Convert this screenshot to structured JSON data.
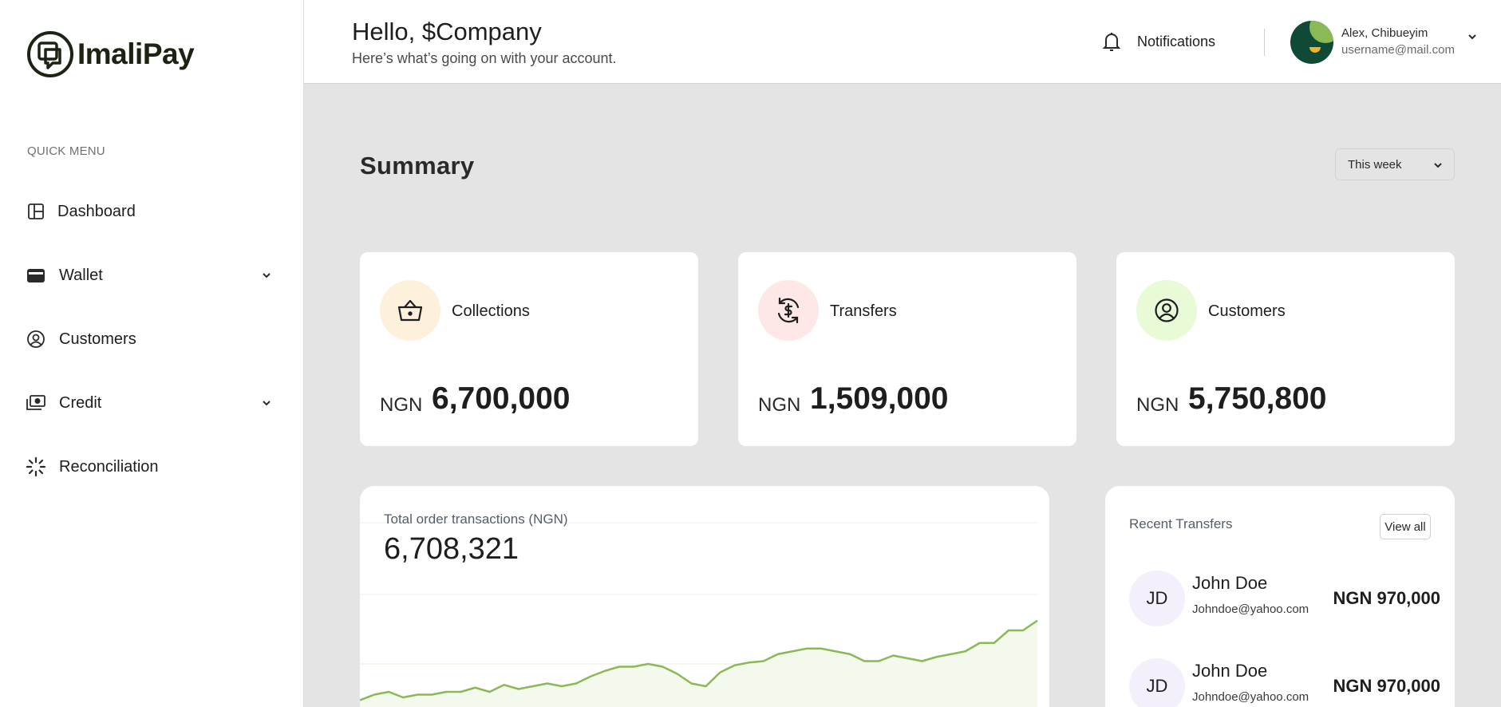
{
  "brand": {
    "name": "ImaliPay",
    "color": "#1b2413"
  },
  "sidebar": {
    "section_label": "QUICK MENU",
    "items": [
      {
        "label": "Dashboard",
        "icon": "dashboard-icon",
        "has_submenu": false
      },
      {
        "label": "Wallet",
        "icon": "wallet-icon",
        "has_submenu": true
      },
      {
        "label": "Customers",
        "icon": "user-circle-icon",
        "has_submenu": false
      },
      {
        "label": "Credit",
        "icon": "cash-icon",
        "has_submenu": true
      },
      {
        "label": "Reconciliation",
        "icon": "loader-icon",
        "has_submenu": false
      }
    ]
  },
  "header": {
    "greeting": "Hello, $Company",
    "subtitle": "Here’s what’s going on with your account.",
    "notifications_label": "Notifications",
    "user": {
      "name": "Alex, Chibueyim",
      "email": "username@mail.com"
    }
  },
  "summary": {
    "title": "Summary",
    "period": {
      "selected": "This week"
    },
    "cards": [
      {
        "label": "Collections",
        "currency": "NGN",
        "amount": "6,700,000",
        "icon": "basket-icon",
        "icon_bg": "#fdf1dc"
      },
      {
        "label": "Transfers",
        "currency": "NGN",
        "amount": "1,509,000",
        "icon": "dollar-refresh-icon",
        "icon_bg": "#fde7e7"
      },
      {
        "label": "Customers",
        "currency": "NGN",
        "amount": "5,750,800",
        "icon": "user-circle-icon",
        "icon_bg": "#e9fad7"
      }
    ]
  },
  "transactions_chart": {
    "title": "Total order transactions (NGN)",
    "total": "6,708,321"
  },
  "chart_data": {
    "type": "area",
    "title": "Total order transactions (NGN)",
    "color": "#8ab956",
    "ylim": [
      0,
      100
    ],
    "values": [
      18,
      22,
      24,
      20,
      22,
      22,
      24,
      24,
      27,
      24,
      29,
      26,
      28,
      30,
      28,
      30,
      35,
      39,
      42,
      42,
      44,
      42,
      37,
      30,
      28,
      38,
      43,
      45,
      46,
      51,
      53,
      55,
      55,
      53,
      51,
      46,
      46,
      50,
      48,
      46,
      49,
      51,
      53,
      59,
      59,
      68,
      68,
      75
    ]
  },
  "recent_transfers": {
    "title": "Recent Transfers",
    "view_all_label": "View all",
    "items": [
      {
        "initials": "JD",
        "name": "John Doe",
        "email": "Johndoe@yahoo.com",
        "amount": "NGN 970,000"
      },
      {
        "initials": "JD",
        "name": "John Doe",
        "email": "Johndoe@yahoo.com",
        "amount": "NGN 970,000"
      }
    ]
  }
}
